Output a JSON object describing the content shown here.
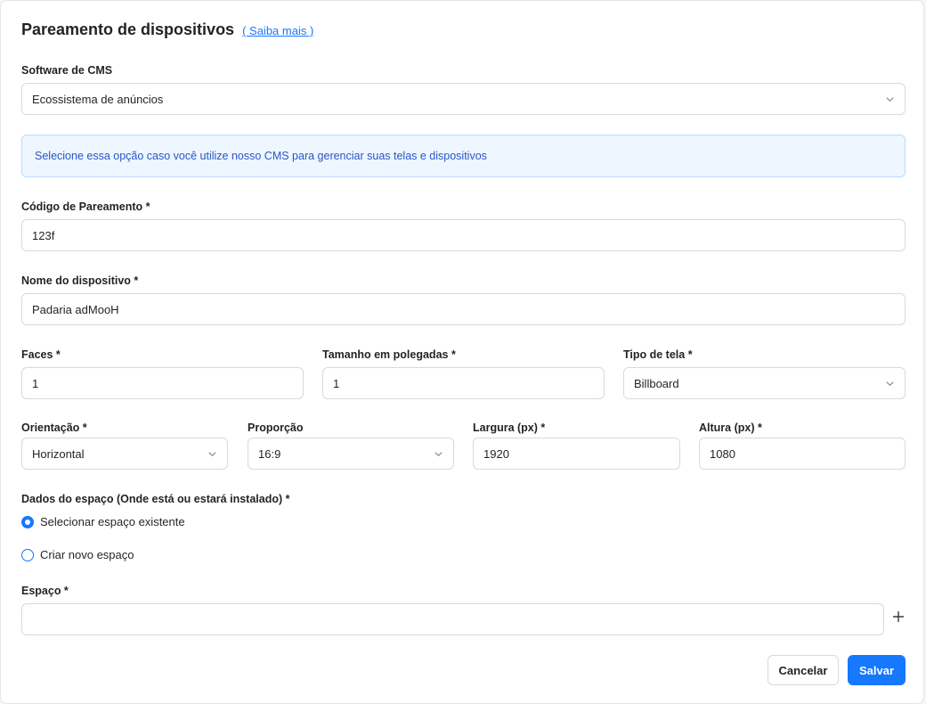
{
  "header": {
    "title": "Pareamento de dispositivos",
    "learn_more": "( Saiba mais )"
  },
  "cms": {
    "label": "Software de CMS",
    "value": "Ecossistema de anúncios",
    "info": "Selecione essa opção caso você utilize nosso CMS para gerenciar suas telas e dispositivos"
  },
  "pairing_code": {
    "label": "Código de Pareamento *",
    "value": "123f"
  },
  "device_name": {
    "label": "Nome do dispositivo *",
    "value": "Padaria adMooH"
  },
  "faces": {
    "label": "Faces *",
    "value": "1"
  },
  "size_inches": {
    "label": "Tamanho em polegadas *",
    "value": "1"
  },
  "screen_type": {
    "label": "Tipo de tela *",
    "value": "Billboard"
  },
  "orientation": {
    "label": "Orientação *",
    "value": "Horizontal"
  },
  "ratio": {
    "label": "Proporção",
    "value": "16:9"
  },
  "width": {
    "label": "Largura (px) *",
    "value": "1920"
  },
  "height": {
    "label": "Altura (px) *",
    "value": "1080"
  },
  "space_data": {
    "label": "Dados do espaço (Onde está ou estará instalado) *",
    "options": [
      {
        "label": "Selecionar espaço existente",
        "checked": true
      },
      {
        "label": "Criar novo espaço",
        "checked": false
      }
    ]
  },
  "space": {
    "label": "Espaço *",
    "value": ""
  },
  "actions": {
    "cancel": "Cancelar",
    "save": "Salvar"
  },
  "icons": {
    "select": "chevron-down-icon",
    "add": "plus-icon"
  },
  "colors": {
    "primary": "#1677ff",
    "alert_bg": "#eef6ff",
    "alert_text": "#2b56c5"
  }
}
